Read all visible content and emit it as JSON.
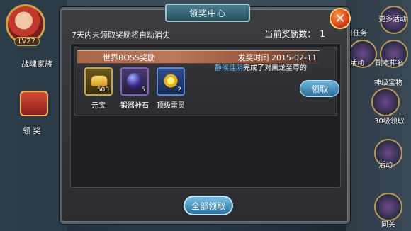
{
  "background": {
    "level": "LV27",
    "left_labels": [
      "战魂家族",
      "领 奖"
    ],
    "right_labels": [
      "更多活动",
      "日任务",
      "活动",
      "副本排名",
      "神级宝物",
      "30级领取",
      "活动",
      "同关"
    ]
  },
  "dialog": {
    "title": "领奖中心",
    "notice": "7天内未领取奖励将自动消失",
    "count_label": "当前奖励数：",
    "count_value": "1",
    "close_icon": "close-icon"
  },
  "item": {
    "source": "世界BOSS奖励",
    "date": "发奖时间 2015-02-11",
    "message_name": "静候佳阴",
    "message_text": "完成了对黑龙至尊的",
    "claim_label": "领取",
    "rewards": [
      {
        "name": "元宝",
        "qty": "500",
        "icon": "gold-ingot-icon"
      },
      {
        "name": "锻器神石",
        "qty": "5",
        "icon": "forge-stone-icon"
      },
      {
        "name": "顶级雷灵",
        "qty": "2",
        "icon": "thunder-spirit-icon"
      }
    ]
  },
  "footer": {
    "claim_all_label": "全部领取"
  },
  "colors": {
    "accent": "#2a6e9a",
    "player_name": "#5fb8ff",
    "ribbon": "#a7664a"
  }
}
